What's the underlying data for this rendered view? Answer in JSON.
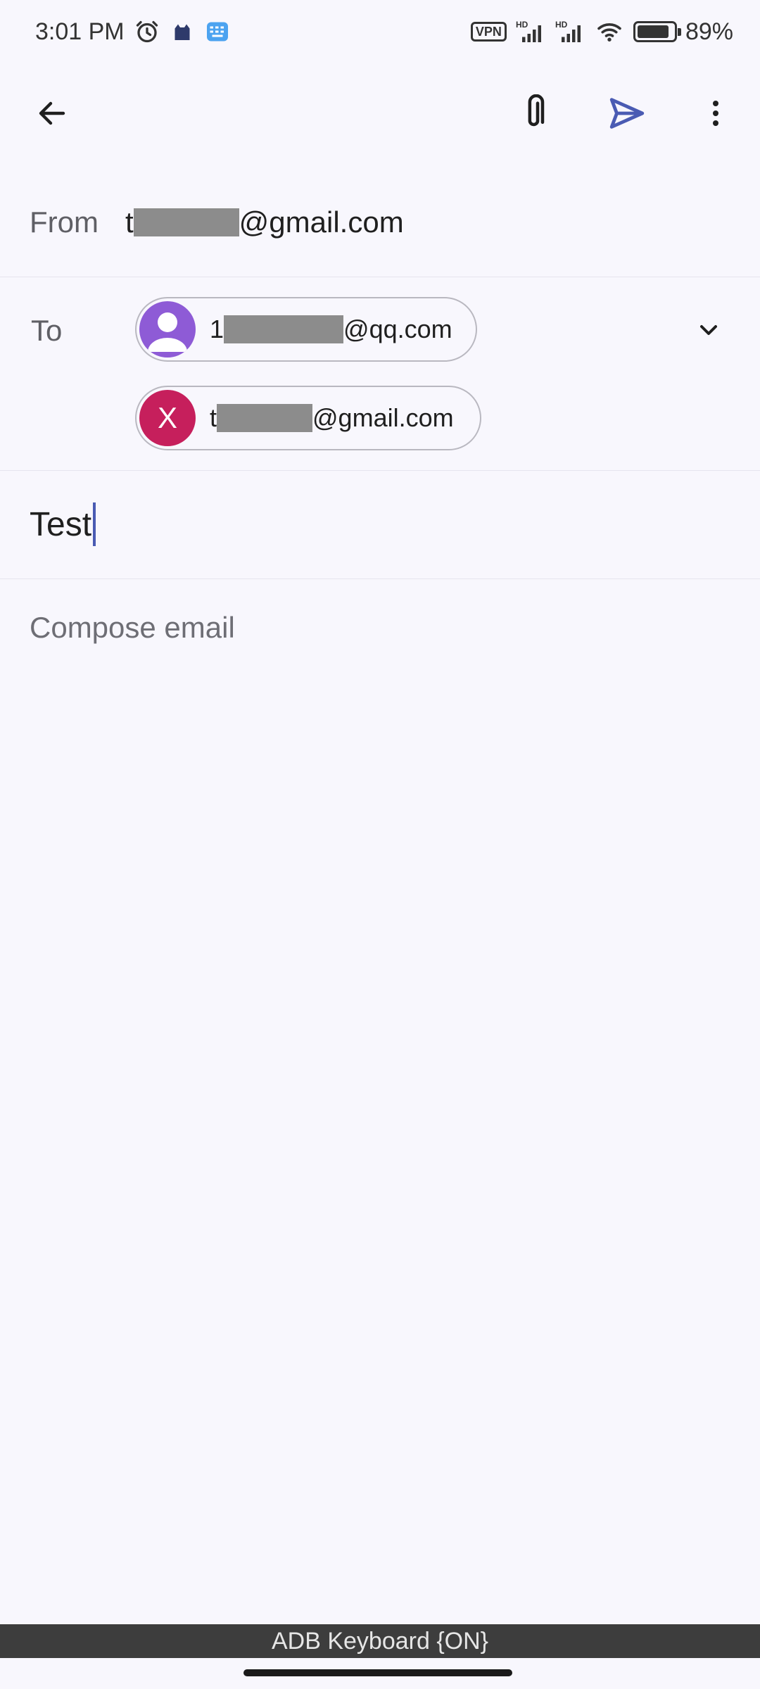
{
  "status_bar": {
    "time": "3:01 PM",
    "vpn": "VPN",
    "battery_percent": "89%",
    "battery_level": 0.89,
    "icons": [
      "alarm-icon",
      "cat-app-icon",
      "keyboard-app-icon",
      "signal-icon",
      "wifi-icon",
      "battery-icon"
    ]
  },
  "toolbar": {
    "back_icon": "arrow-left-icon",
    "attach_icon": "paperclip-icon",
    "send_icon": "send-icon",
    "more_icon": "more-vertical-icon"
  },
  "from": {
    "label": "From",
    "value_prefix": "t",
    "value_suffix": "@gmail.com"
  },
  "to": {
    "label": "To",
    "recipients": [
      {
        "prefix": "1",
        "suffix": "@qq.com",
        "avatar": "person-icon",
        "avatar_color": "#8e5bd6"
      },
      {
        "prefix": "t",
        "suffix": "@gmail.com",
        "avatar_letter": "X",
        "avatar_color": "#c61f5c"
      }
    ],
    "expand_icon": "chevron-down-icon"
  },
  "subject": {
    "value": "Test"
  },
  "body": {
    "placeholder": "Compose email"
  },
  "keyboard": {
    "label": "ADB Keyboard {ON}"
  },
  "colors": {
    "background": "#f8f7fd",
    "accent": "#4a5bb3",
    "divider": "#e6e4ee"
  }
}
